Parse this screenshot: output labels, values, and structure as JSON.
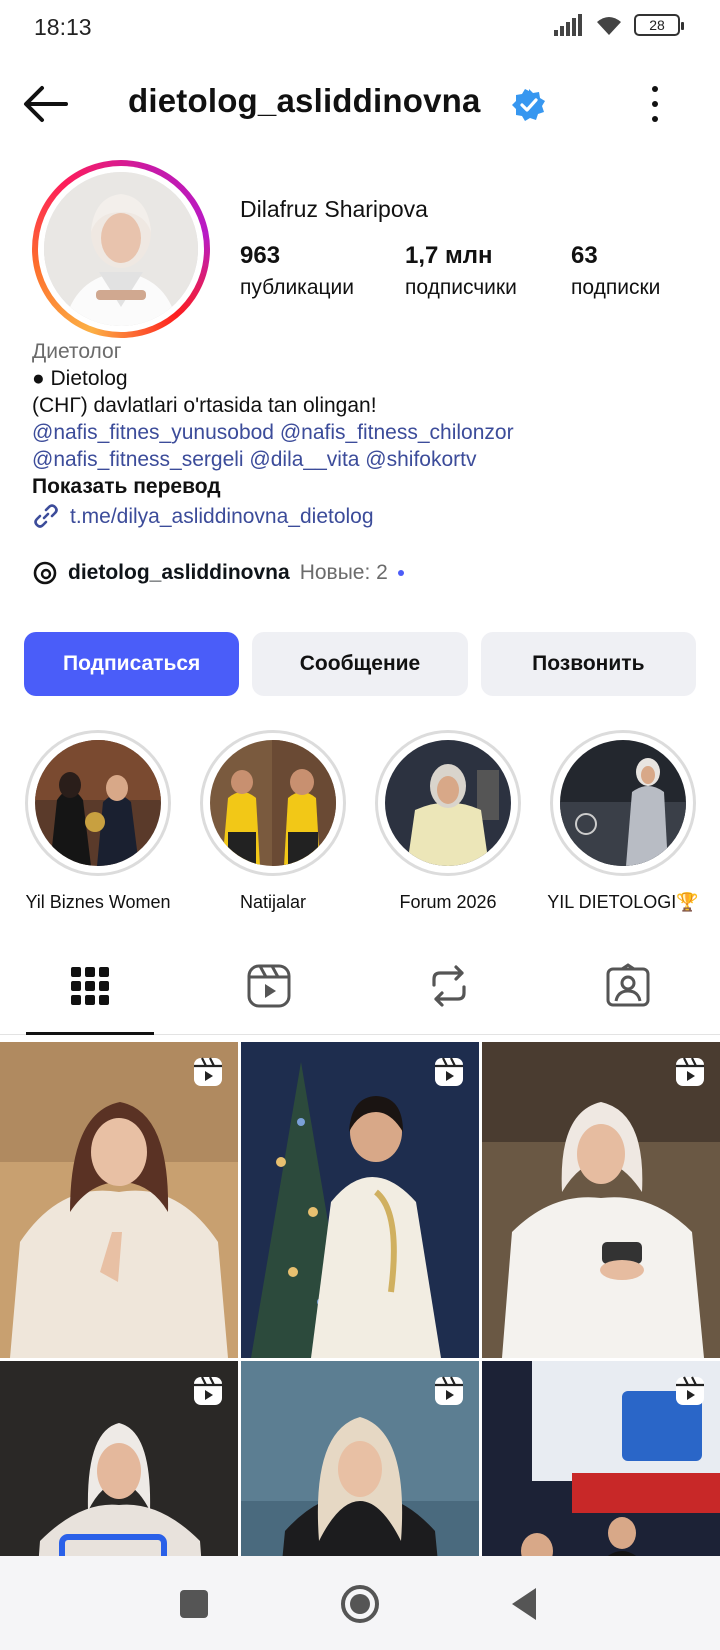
{
  "status_bar": {
    "time": "18:13",
    "battery": "28"
  },
  "header": {
    "username": "dietolog_asliddinovna",
    "back_icon": "arrow-left-icon",
    "more_icon": "more-vertical-icon",
    "verified_icon": "verified-badge-icon"
  },
  "profile": {
    "full_name": "Dilafruz Sharipova",
    "stats": [
      {
        "value": "963",
        "label": "публикации"
      },
      {
        "value": "1,7 млн",
        "label": "подписчики"
      },
      {
        "value": "63",
        "label": "подписки"
      }
    ]
  },
  "bio": {
    "category": "Диетолог",
    "line1": "● Dietolog",
    "line2": " (СНГ) davlatlari o'rtasida tan olingan!",
    "mentions_line1": "@nafis_fitnes_yunusobod @nafis_fitness_chilonzor",
    "mentions_line2": "@nafis_fitness_sergeli @dila__vita @shifokortv",
    "translate": "Показать перевод",
    "link": "t.me/dilya_asliddinovna_dietolog"
  },
  "threads": {
    "handle": "dietolog_asliddinovna",
    "news": "Новые: 2"
  },
  "actions": {
    "follow": "Подписаться",
    "message": "Сообщение",
    "call": "Позвонить"
  },
  "highlights": [
    {
      "label": "Yil Biznes Women"
    },
    {
      "label": "Natijalar"
    },
    {
      "label": "Forum 2026"
    },
    {
      "label": "YIL DIETOLOGI🏆"
    }
  ],
  "tabs": [
    {
      "name": "grid-icon"
    },
    {
      "name": "reels-icon"
    },
    {
      "name": "reposts-icon"
    },
    {
      "name": "tagged-icon"
    }
  ],
  "colors": {
    "accent": "#4a5df9",
    "mention": "#3c4c9a",
    "muted": "#6b6b6b"
  }
}
